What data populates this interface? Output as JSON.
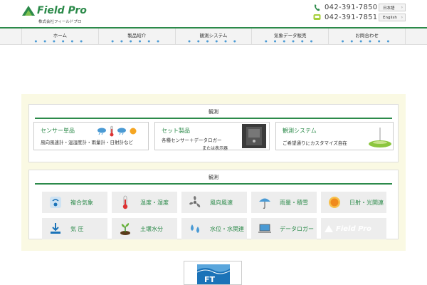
{
  "header": {
    "logo_text": "Field Pro",
    "company": "株式会社フィールドプロ",
    "phones": [
      "042-391-7850",
      "042-391-7851"
    ],
    "lang_buttons": [
      "日本語",
      "English"
    ]
  },
  "nav": {
    "items": [
      "ホーム",
      "製品紹介",
      "観測システム",
      "気象データ販売",
      "お問合わせ"
    ]
  },
  "section1": {
    "title": "観測",
    "cards": [
      {
        "title": "センサー単品",
        "desc": "風向風速計・温湿度計・雨量計・日射計など"
      },
      {
        "title": "セット製品",
        "desc": "各種センサー＋データロガー",
        "desc2": "または表示器"
      },
      {
        "title": "観測システム",
        "desc": "ご希望通りにカスタマイズ自在"
      }
    ]
  },
  "section2": {
    "title": "観測",
    "tiles": [
      {
        "label": "複合気象",
        "icon": "compound-weather-icon"
      },
      {
        "label": "温度・湿度",
        "icon": "thermometer-icon"
      },
      {
        "label": "風向風速",
        "icon": "fan-icon"
      },
      {
        "label": "雨量・積雪",
        "icon": "umbrella-icon"
      },
      {
        "label": "日射・光関連",
        "icon": "sun-icon"
      },
      {
        "label": "気 圧",
        "icon": "pressure-icon"
      },
      {
        "label": "土壌水分",
        "icon": "sprout-icon"
      },
      {
        "label": "水位・水関連",
        "icon": "water-drops-icon"
      },
      {
        "label": "データロガー",
        "icon": "laptop-icon"
      },
      {
        "label": "Field Pro",
        "icon": "fieldpro-logo-icon"
      }
    ]
  },
  "footer": {
    "ft_logo": "FT"
  },
  "colors": {
    "brand_green": "#2c8a4a",
    "panel_bg": "#faf9e3",
    "tile_bg": "#ededed",
    "ft_blue": "#1b73b8"
  }
}
